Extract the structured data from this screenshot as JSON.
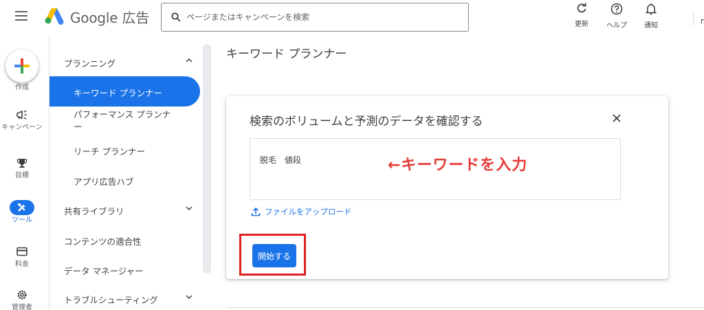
{
  "app": {
    "brand": "Google 広告"
  },
  "search": {
    "placeholder": "ページまたはキャンペーンを検索"
  },
  "topbar": {
    "refresh_label": "更新",
    "help_label": "ヘルプ",
    "notify_label": "通知",
    "edge_text": "n"
  },
  "rail": {
    "create_label": "作成",
    "items": [
      {
        "label": "キャンペーン",
        "icon": "megaphone-icon"
      },
      {
        "label": "目標",
        "icon": "trophy-icon"
      },
      {
        "label": "ツール",
        "icon": "tools-icon",
        "active": true
      },
      {
        "label": "料金",
        "icon": "credit-card-icon"
      },
      {
        "label": "管理者",
        "icon": "gear-icon"
      }
    ]
  },
  "nav": {
    "section_planning": "プランニング",
    "items_planning": [
      "キーワード プランナー",
      "パフォーマンス プランナー",
      "リーチ プランナー",
      "アプリ広告ハブ"
    ],
    "selected": "キーワード プランナー",
    "section_library": "共有ライブラリ",
    "content_suitability": "コンテンツの適合性",
    "data_manager": "データ マネージャー",
    "troubleshooting": "トラブルシューティング"
  },
  "main": {
    "page_title": "キーワード プランナー",
    "card_title": "検索のボリュームと予測のデータを確認する",
    "keyword_value": "脱毛　値段",
    "annotation": "←キーワードを入力",
    "upload_label": "ファイルをアップロード",
    "start_label": "開始する"
  },
  "colors": {
    "accent": "#1a73e8",
    "annotation": "#e53935",
    "highlight_box": "#e02020"
  }
}
